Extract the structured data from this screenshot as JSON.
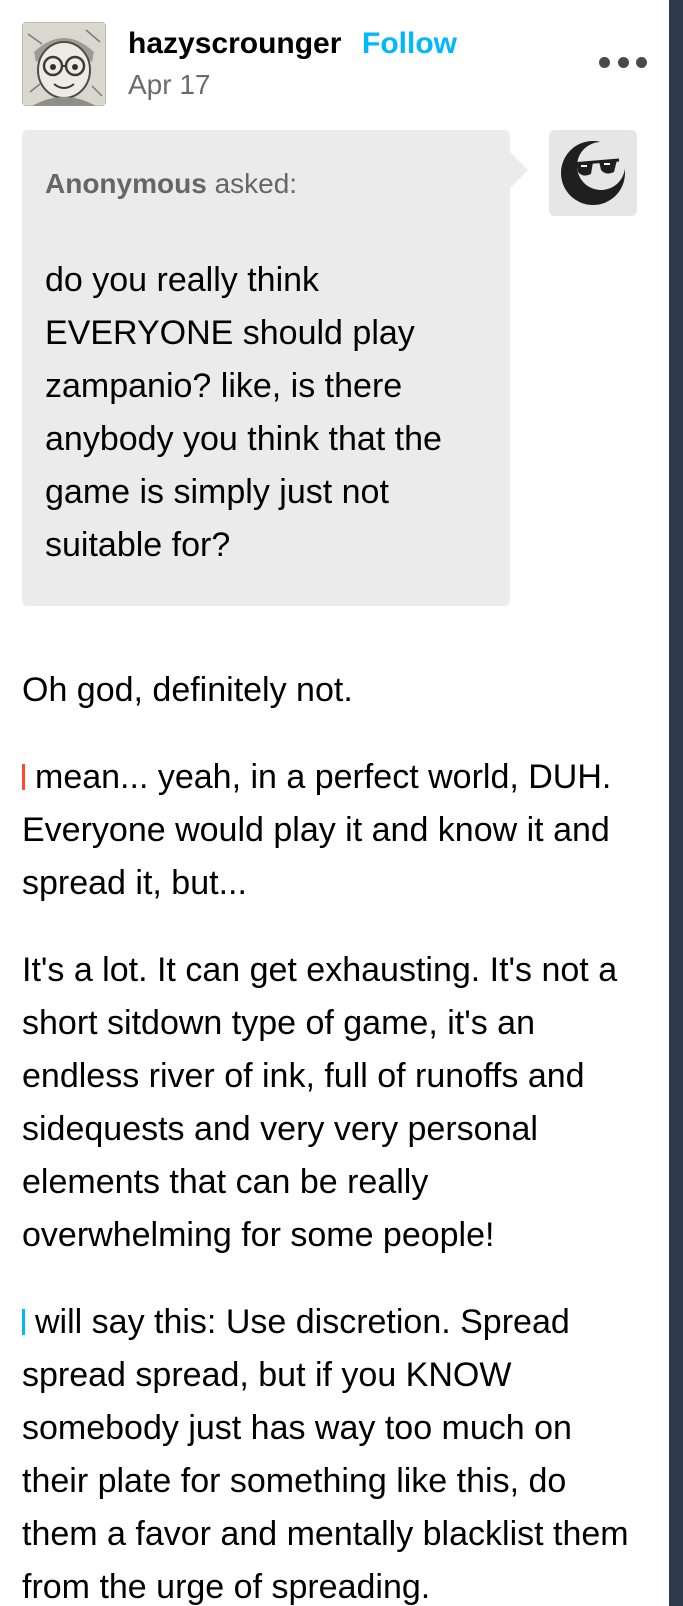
{
  "post": {
    "username": "hazyscrounger",
    "follow_label": "Follow",
    "date": "Apr 17",
    "more_icon": "more-horizontal-icon",
    "colors": {
      "follow": "#00b8ff",
      "cursor_red": "#ff4930",
      "cursor_blue": "#00b8ff"
    }
  },
  "ask": {
    "asker_name": "Anonymous",
    "asked_label": "asked:",
    "question": "do you really think EVERYONE should play zampanio? like, is there anybody you think that the game is simply just not suitable for?",
    "avatar_icon": "anonymous-sunglasses-icon"
  },
  "answer": {
    "p1": "Oh god, definitely not.",
    "p2": "mean... yeah, in a perfect world, DUH. Everyone would play it and know it and spread it, but...",
    "p3": "It's a lot. It can get exhausting. It's not a short sitdown type of game, it's an endless river of ink, full of runoffs and sidequests and very very personal elements that can be really overwhelming for some people!",
    "p4": "will say this: Use discretion. Spread spread spread, but if you KNOW somebody just has way too much on their plate for something like this, do them a favor and mentally blacklist them from the urge of spreading."
  }
}
